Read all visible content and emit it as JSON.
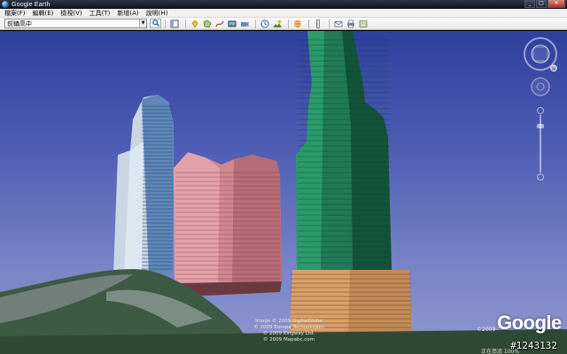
{
  "window": {
    "title": "Google Earth",
    "buttons": [
      "_",
      "□",
      "✕"
    ]
  },
  "menu": {
    "items": [
      "檔案(F)",
      "編輯(E)",
      "檢視(V)",
      "工具(T)",
      "新增(A)",
      "說明(H)"
    ]
  },
  "toolbar": {
    "search_value": "前鎮高中",
    "tools": [
      "hide-sidebar-icon",
      "placemark-icon",
      "polygon-icon",
      "path-icon",
      "image-overlay-icon",
      "record-tour-icon",
      "historical-imagery-icon",
      "sun-icon",
      "switch-sky-icon",
      "ruler-icon",
      "email-icon",
      "print-icon",
      "view-in-maps-icon"
    ]
  },
  "view": {
    "logo": "Google",
    "image_id": "#1243132",
    "year_label": "©2009",
    "status_text": "正在串流 100%",
    "copyright_lines": [
      "Image © 2009 DigitalGlobe",
      "© 2009 Europa Technologies",
      "© 2009 Kingway Ltd.",
      "© 2009 Mapabc.com"
    ],
    "compass_label": "N"
  },
  "colors": {
    "sky_top": "#2f3f9d",
    "tower_green": "#1f7a55",
    "tower_pink": "#d48a93",
    "tower_white": "#dde6ef"
  }
}
